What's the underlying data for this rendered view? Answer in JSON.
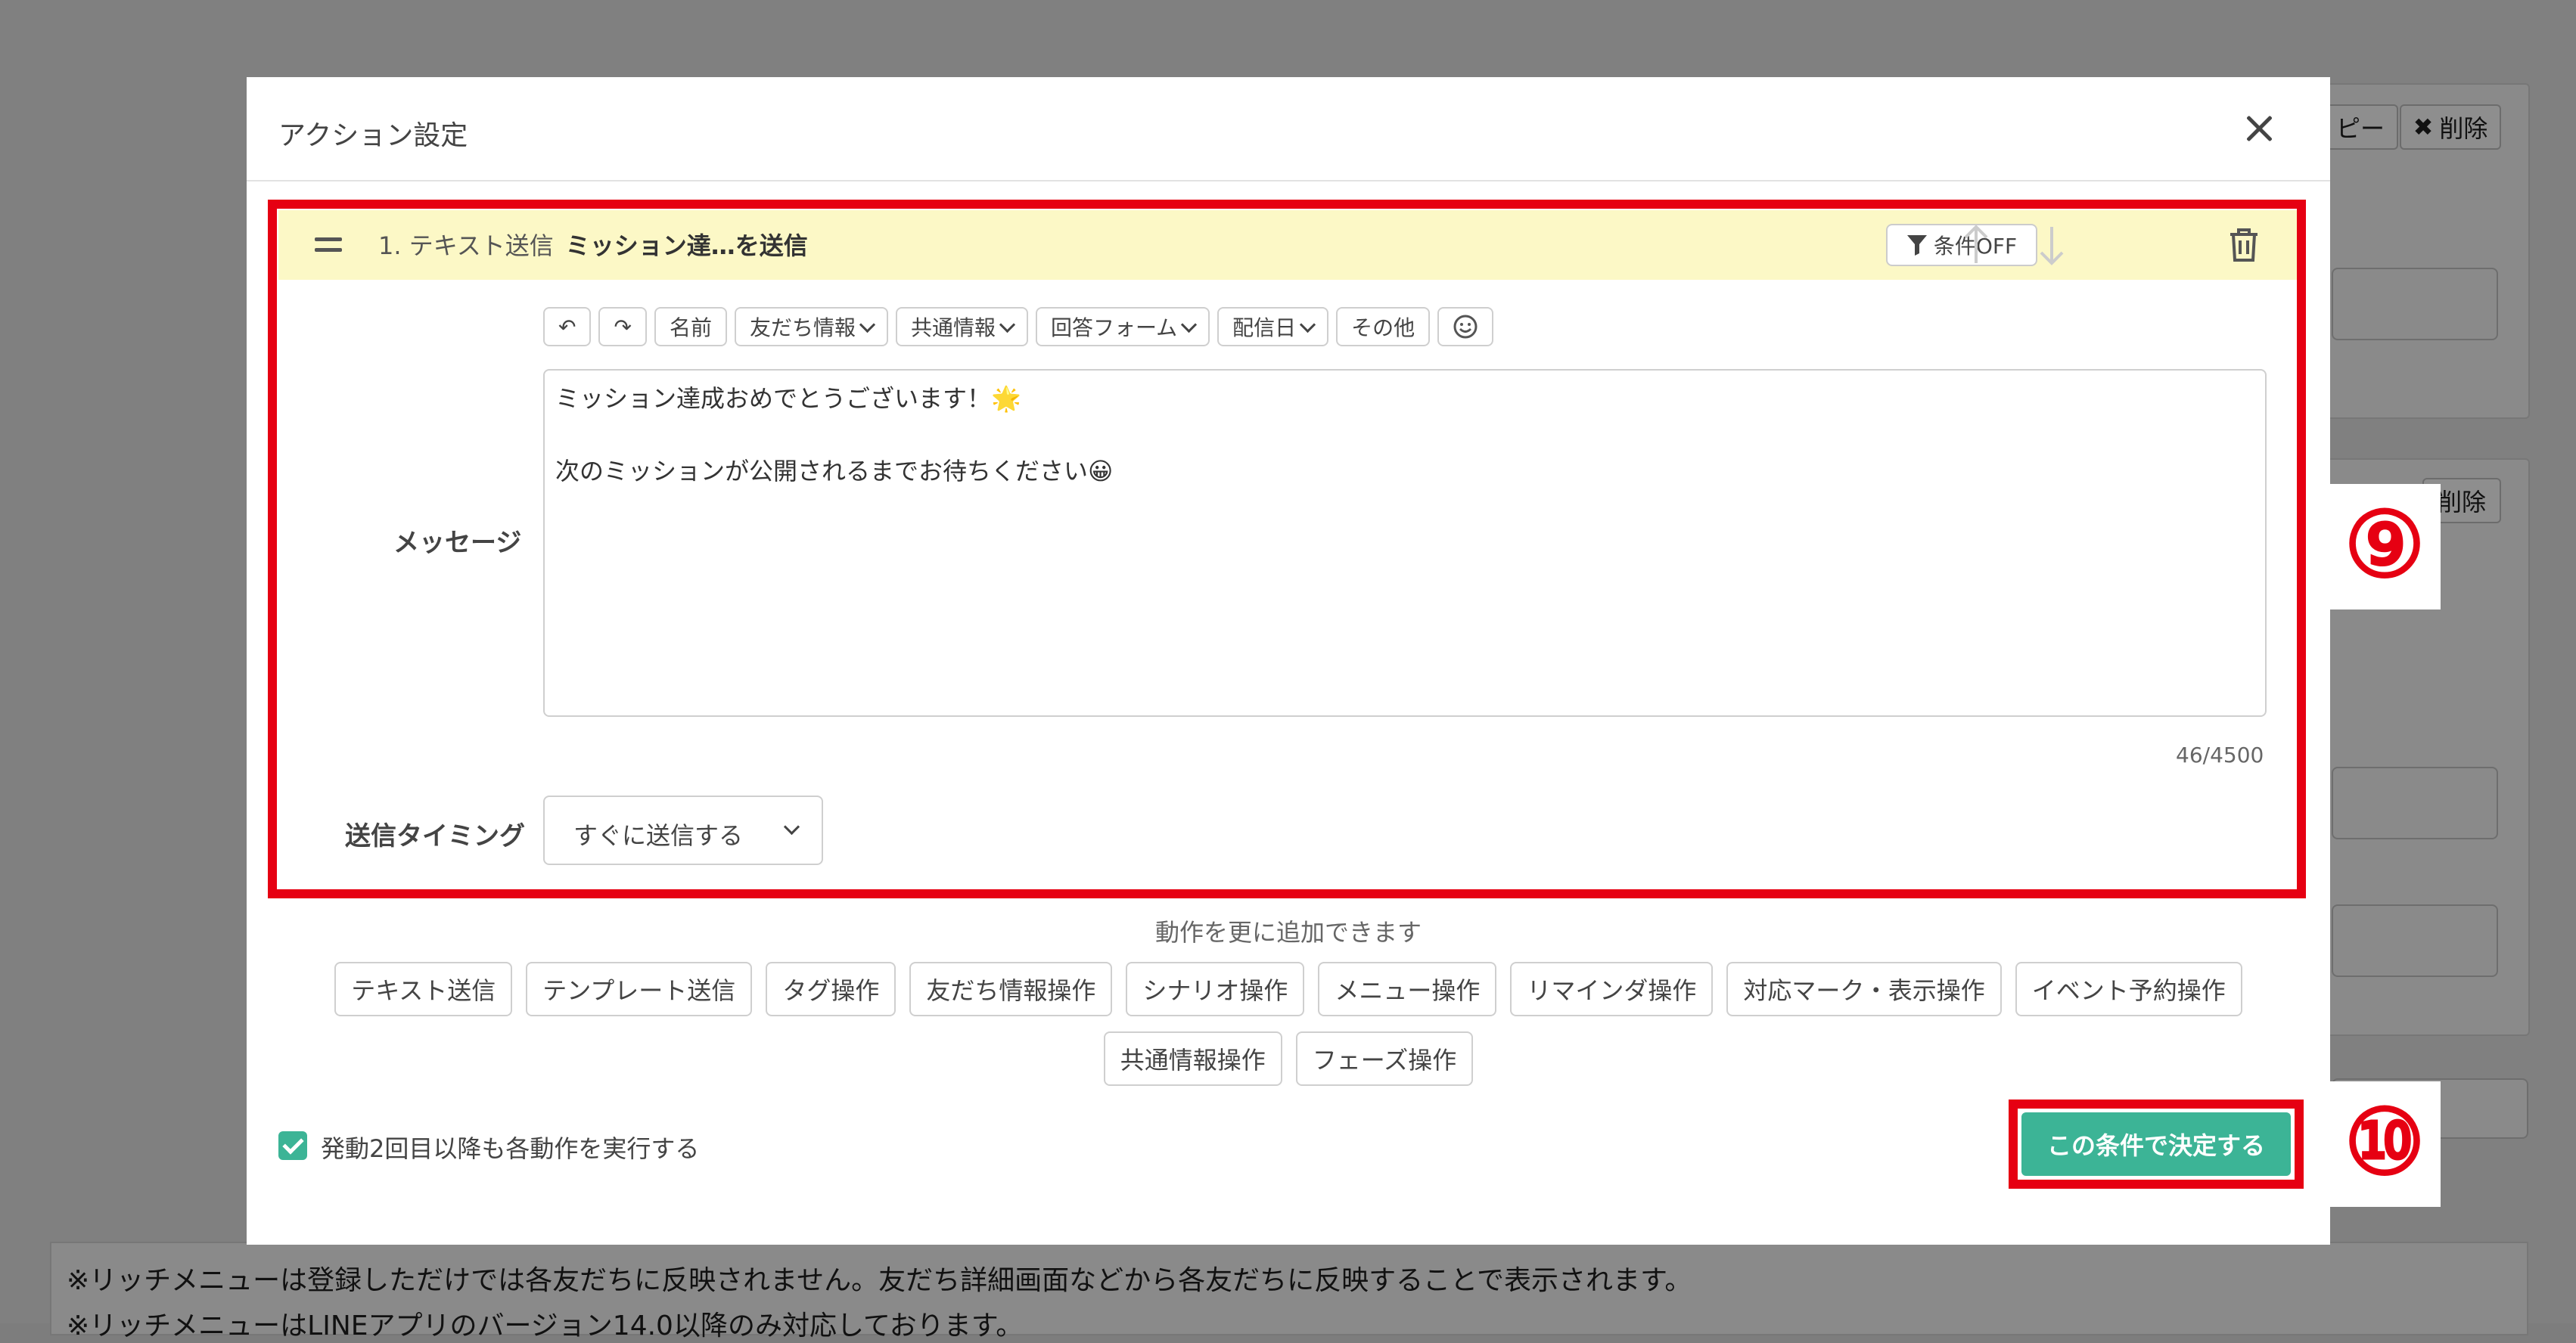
{
  "modal": {
    "title": "アクション設定"
  },
  "action": {
    "number_label": "1. テキスト送信",
    "name": "ミッション達…を送信",
    "condition_button": "条件OFF"
  },
  "toolbar": {
    "items": [
      "名前",
      "友だち情報",
      "共通情報",
      "回答フォーム",
      "配信日",
      "その他"
    ]
  },
  "message": {
    "label": "メッセージ",
    "line1": "ミッション達成おめでとうございます！🌟",
    "line2": "次のミッションが公開されるまでお待ちください😀",
    "counter": "46/4500"
  },
  "timing": {
    "label": "送信タイミング",
    "value": "すぐに送信する"
  },
  "add_more": {
    "text": "動作を更に追加できます",
    "row1": [
      "テキスト送信",
      "テンプレート送信",
      "タグ操作",
      "友だち情報操作",
      "シナリオ操作",
      "メニュー操作",
      "リマインダ操作",
      "対応マーク・表示操作",
      "イベント予約操作"
    ],
    "row2": [
      "共通情報操作",
      "フェーズ操作"
    ]
  },
  "repeat_checkbox": {
    "label": "発動2回目以降も各動作を実行する",
    "checked": true
  },
  "submit_button": "この条件で決定する",
  "annotations": {
    "step9": "⑨",
    "step10": "⑩"
  },
  "background": {
    "copy_btn": "ピー",
    "delete_btn1": "削除",
    "delete_btn2": "削除",
    "note_line1": "※リッチメニューは登録しただけでは各友だちに反映されません。友だち詳細画面などから各友だちに反映することで表示されます。",
    "note_line2": "※リッチメニューはLINEアプリのバージョン14.0以降のみ対応しております。"
  },
  "colors": {
    "accent": "#3cb496",
    "highlight": "#e60012",
    "header_bg": "#fcf8c6"
  }
}
